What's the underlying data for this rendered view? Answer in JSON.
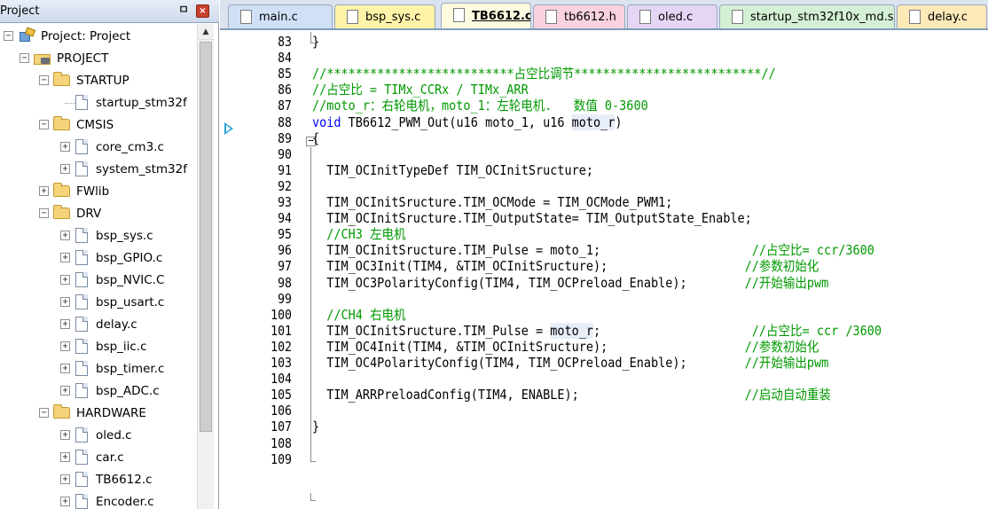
{
  "panel": {
    "title": "Project",
    "pin": "ㅁ",
    "close": "×",
    "tree": [
      {
        "label": "Project: Project",
        "kind": "project",
        "expander": "-"
      },
      {
        "label": "PROJECT",
        "kind": "target",
        "expander": "-"
      },
      {
        "label": "STARTUP",
        "kind": "folder",
        "expander": "-"
      },
      {
        "label": "startup_stm32f",
        "kind": "file",
        "expander": ""
      },
      {
        "label": "CMSIS",
        "kind": "folder",
        "expander": "-"
      },
      {
        "label": "core_cm3.c",
        "kind": "file",
        "expander": "+"
      },
      {
        "label": "system_stm32f",
        "kind": "file",
        "expander": "+"
      },
      {
        "label": "FWlib",
        "kind": "folder",
        "expander": "+"
      },
      {
        "label": "DRV",
        "kind": "folder",
        "expander": "-"
      },
      {
        "label": "bsp_sys.c",
        "kind": "file",
        "expander": "+"
      },
      {
        "label": "bsp_GPIO.c",
        "kind": "file",
        "expander": "+"
      },
      {
        "label": "bsp_NVIC.C",
        "kind": "file",
        "expander": "+"
      },
      {
        "label": "bsp_usart.c",
        "kind": "file",
        "expander": "+"
      },
      {
        "label": "delay.c",
        "kind": "file",
        "expander": "+"
      },
      {
        "label": "bsp_iic.c",
        "kind": "file",
        "expander": "+"
      },
      {
        "label": "bsp_timer.c",
        "kind": "file",
        "expander": "+"
      },
      {
        "label": "bsp_ADC.c",
        "kind": "file",
        "expander": "+"
      },
      {
        "label": "HARDWARE",
        "kind": "folder",
        "expander": "-"
      },
      {
        "label": "oled.c",
        "kind": "file",
        "expander": "+"
      },
      {
        "label": "car.c",
        "kind": "file",
        "expander": "+"
      },
      {
        "label": "TB6612.c",
        "kind": "file",
        "expander": "+"
      },
      {
        "label": "Encoder.c",
        "kind": "file",
        "expander": "+"
      }
    ]
  },
  "tabs": [
    {
      "label": "main.c",
      "color": "#cfe0f7",
      "active": false
    },
    {
      "label": "bsp_sys.c",
      "color": "#fff3a8",
      "active": false
    },
    {
      "label": "TB6612.c",
      "color": "#fffbe0",
      "active": true
    },
    {
      "label": "tb6612.h",
      "color": "#f9d2de",
      "active": false
    },
    {
      "label": "oled.c",
      "color": "#e4d6f4",
      "active": false
    },
    {
      "label": "startup_stm32f10x_md.s",
      "color": "#d4f0d4",
      "active": false
    },
    {
      "label": "delay.c",
      "color": "#fde8b8",
      "active": false
    }
  ],
  "editor": {
    "first_line": 83,
    "lines": [
      "}",
      "",
      "//**************************占空比调节**************************//",
      "//占空比 = TIMx_CCRx / TIMx_ARR",
      "//moto_r：右轮电机，moto_1：左轮电机.   数值 0-3600",
      "void TB6612_PWM_Out(u16 moto_1, u16 moto_r)",
      "{",
      "",
      "  TIM_OCInitTypeDef TIM_OCInitSructure;",
      "",
      "  TIM_OCInitSructure.TIM_OCMode = TIM_OCMode_PWM1;",
      "  TIM_OCInitSructure.TIM_OutputState= TIM_OutputState_Enable;",
      "  //CH3 左电机",
      "  TIM_OCInitSructure.TIM_Pulse = moto_1;                     //占空比= ccr/3600",
      "  TIM_OC3Init(TIM4, &TIM_OCInitSructure);                   //参数初始化",
      "  TIM_OC3PolarityConfig(TIM4, TIM_OCPreload_Enable);        //开始输出pwm",
      "",
      "  //CH4 右电机",
      "  TIM_OCInitSructure.TIM_Pulse = moto_r;                     //占空比= ccr /3600",
      "  TIM_OC4Init(TIM4, &TIM_OCInitSructure);                   //参数初始化",
      "  TIM_OC4PolarityConfig(TIM4, TIM_OCPreload_Enable);        //开始输出pwm",
      "",
      "  TIM_ARRPreloadConfig(TIM4, ENABLE);                       //启动自动重装",
      "",
      "}",
      "",
      ""
    ]
  }
}
